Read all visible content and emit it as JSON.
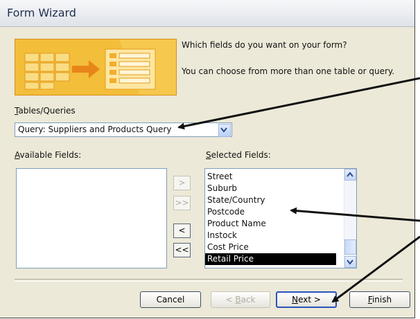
{
  "window": {
    "title": "Form Wizard"
  },
  "prompt": {
    "line1": "Which fields do you want on your form?",
    "line2": "You can choose from more than one table or query."
  },
  "tables_queries": {
    "label_key": "T",
    "label_rest": "ables/Queries",
    "selected": "Query: Suppliers and Products Query"
  },
  "available": {
    "label_key": "A",
    "label_rest": "vailable Fields:",
    "items": []
  },
  "selected": {
    "label_key": "S",
    "label_rest": "elected Fields:",
    "items": [
      "Street",
      "Suburb",
      "State/Country",
      "Postcode",
      "Product Name",
      "Instock",
      "Cost Price",
      "Retail Price"
    ],
    "highlighted": "Retail Price"
  },
  "move_buttons": {
    "add_one": ">",
    "add_all": ">>",
    "remove_one": "<",
    "remove_all": "<<"
  },
  "buttons": {
    "cancel": "Cancel",
    "back_key": "B",
    "back_pre": "< ",
    "back_rest": "ack",
    "next_key": "N",
    "next_rest": "ext >",
    "finish_key": "F",
    "finish_rest": "inish"
  },
  "colors": {
    "banner": "#f0b52a",
    "selection": "#000000",
    "arrow": "#111111"
  }
}
